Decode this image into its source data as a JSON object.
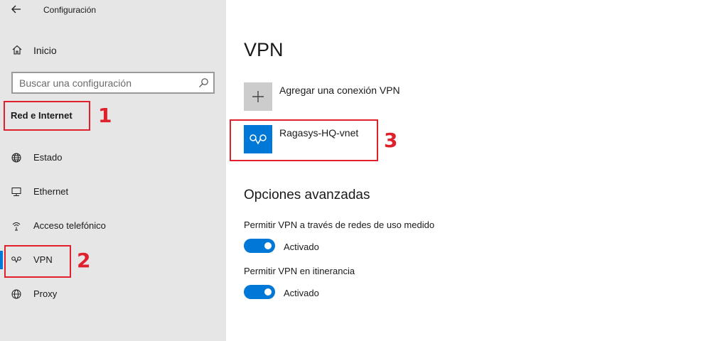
{
  "window": {
    "title": "Configuración"
  },
  "sidebar": {
    "home_label": "Inicio",
    "search_placeholder": "Buscar una configuración",
    "section_title": "Red e Internet",
    "items": [
      {
        "label": "Estado",
        "icon": "globe-status-icon",
        "selected": false
      },
      {
        "label": "Ethernet",
        "icon": "ethernet-icon",
        "selected": false
      },
      {
        "label": "Acceso telefónico",
        "icon": "dialup-icon",
        "selected": false
      },
      {
        "label": "VPN",
        "icon": "vpn-icon",
        "selected": true
      },
      {
        "label": "Proxy",
        "icon": "globe-icon",
        "selected": false
      }
    ]
  },
  "main": {
    "title": "VPN",
    "add_connection_label": "Agregar una conexión VPN",
    "connections": [
      {
        "name": "Ragasys-HQ-vnet"
      }
    ],
    "advanced_title": "Opciones avanzadas",
    "options": [
      {
        "label": "Permitir VPN a través de redes de uso medido",
        "state": "Activado",
        "on": true
      },
      {
        "label": "Permitir VPN en itinerancia",
        "state": "Activado",
        "on": true
      }
    ]
  },
  "annotations": [
    "1",
    "2",
    "3"
  ],
  "colors": {
    "accent": "#0078d7",
    "sidebar_bg": "#e6e6e6",
    "annotation": "#e0202b",
    "add_tile": "#cccccc"
  }
}
